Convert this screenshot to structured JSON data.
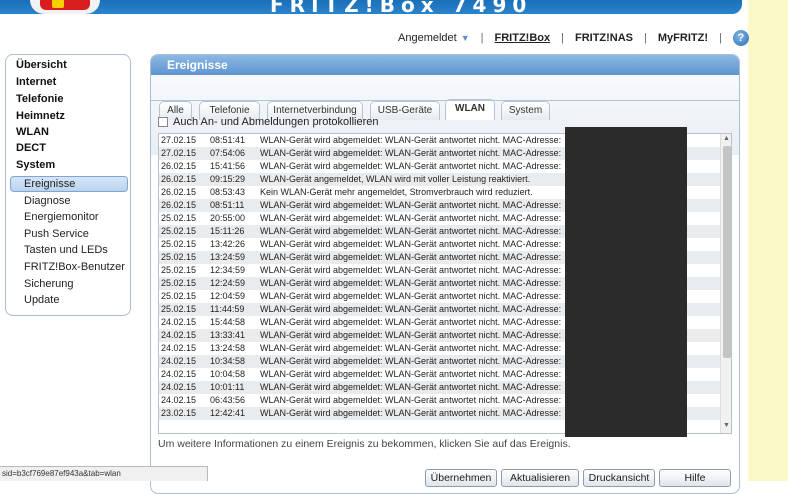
{
  "header": {
    "brand": "FRITZ!Box 7490"
  },
  "topnav": {
    "angemeldet": "Angemeldet",
    "fritzbox": "FRITZ!Box",
    "fritznas": "FRITZ!NAS",
    "myfritz": "MyFRITZ!",
    "sep": "|",
    "help": "?"
  },
  "menu": {
    "main": [
      "Übersicht",
      "Internet",
      "Telefonie",
      "Heimnetz",
      "WLAN",
      "DECT",
      "System"
    ],
    "sub": [
      "Ereignisse",
      "Diagnose",
      "Energiemonitor",
      "Push Service",
      "Tasten und LEDs",
      "FRITZ!Box-Benutzer",
      "Sicherung",
      "Update"
    ]
  },
  "panel": {
    "title": "Ereignisse",
    "tabs": [
      "Alle",
      "Telefonie",
      "Internetverbindung",
      "USB-Geräte",
      "WLAN",
      "System"
    ],
    "active_tab": "WLAN",
    "checkbox_label": "Auch An- und Abmeldungen protokollieren",
    "info": "Um weitere Informationen zu einem Ereignis zu bekommen, klicken Sie auf das Ereignis."
  },
  "events": [
    {
      "date": "27.02.15",
      "time": "08:51:41",
      "msg": "WLAN-Gerät wird abgemeldet: WLAN-Gerät antwortet nicht. MAC-Adresse:"
    },
    {
      "date": "27.02.15",
      "time": "07:54:06",
      "msg": "WLAN-Gerät wird abgemeldet: WLAN-Gerät antwortet nicht. MAC-Adresse:"
    },
    {
      "date": "26.02.15",
      "time": "15:41:56",
      "msg": "WLAN-Gerät wird abgemeldet: WLAN-Gerät antwortet nicht. MAC-Adresse:"
    },
    {
      "date": "26.02.15",
      "time": "09:15:29",
      "msg": "WLAN-Gerät angemeldet, WLAN wird mit voller Leistung reaktiviert."
    },
    {
      "date": "26.02.15",
      "time": "08:53:43",
      "msg": "Kein WLAN-Gerät mehr angemeldet, Stromverbrauch wird reduziert."
    },
    {
      "date": "26.02.15",
      "time": "08:51:11",
      "msg": "WLAN-Gerät wird abgemeldet: WLAN-Gerät antwortet nicht. MAC-Adresse:"
    },
    {
      "date": "25.02.15",
      "time": "20:55:00",
      "msg": "WLAN-Gerät wird abgemeldet: WLAN-Gerät antwortet nicht. MAC-Adresse:"
    },
    {
      "date": "25.02.15",
      "time": "15:11:26",
      "msg": "WLAN-Gerät wird abgemeldet: WLAN-Gerät antwortet nicht. MAC-Adresse:"
    },
    {
      "date": "25.02.15",
      "time": "13:42:26",
      "msg": "WLAN-Gerät wird abgemeldet: WLAN-Gerät antwortet nicht. MAC-Adresse:"
    },
    {
      "date": "25.02.15",
      "time": "13:24:59",
      "msg": "WLAN-Gerät wird abgemeldet: WLAN-Gerät antwortet nicht. MAC-Adresse:"
    },
    {
      "date": "25.02.15",
      "time": "12:34:59",
      "msg": "WLAN-Gerät wird abgemeldet: WLAN-Gerät antwortet nicht. MAC-Adresse:"
    },
    {
      "date": "25.02.15",
      "time": "12:24:59",
      "msg": "WLAN-Gerät wird abgemeldet: WLAN-Gerät antwortet nicht. MAC-Adresse:"
    },
    {
      "date": "25.02.15",
      "time": "12:04:59",
      "msg": "WLAN-Gerät wird abgemeldet: WLAN-Gerät antwortet nicht. MAC-Adresse:"
    },
    {
      "date": "25.02.15",
      "time": "11:44:59",
      "msg": "WLAN-Gerät wird abgemeldet: WLAN-Gerät antwortet nicht. MAC-Adresse:"
    },
    {
      "date": "24.02.15",
      "time": "15:44:58",
      "msg": "WLAN-Gerät wird abgemeldet: WLAN-Gerät antwortet nicht. MAC-Adresse:"
    },
    {
      "date": "24.02.15",
      "time": "13:33:41",
      "msg": "WLAN-Gerät wird abgemeldet: WLAN-Gerät antwortet nicht. MAC-Adresse:"
    },
    {
      "date": "24.02.15",
      "time": "13:24:58",
      "msg": "WLAN-Gerät wird abgemeldet: WLAN-Gerät antwortet nicht. MAC-Adresse:"
    },
    {
      "date": "24.02.15",
      "time": "10:34:58",
      "msg": "WLAN-Gerät wird abgemeldet: WLAN-Gerät antwortet nicht. MAC-Adresse:"
    },
    {
      "date": "24.02.15",
      "time": "10:04:58",
      "msg": "WLAN-Gerät wird abgemeldet: WLAN-Gerät antwortet nicht. MAC-Adresse:"
    },
    {
      "date": "24.02.15",
      "time": "10:01:11",
      "msg": "WLAN-Gerät wird abgemeldet: WLAN-Gerät antwortet nicht. MAC-Adresse:"
    },
    {
      "date": "24.02.15",
      "time": "06:43:56",
      "msg": "WLAN-Gerät wird abgemeldet: WLAN-Gerät antwortet nicht. MAC-Adresse:"
    },
    {
      "date": "23.02.15",
      "time": "12:42:41",
      "msg": "WLAN-Gerät wird abgemeldet: WLAN-Gerät antwortet nicht. MAC-Adresse:"
    }
  ],
  "buttons": [
    "Übernehmen",
    "Aktualisieren",
    "Druckansicht",
    "Hilfe"
  ],
  "status_url": "sid=b3cf769e87ef943a&tab=wlan",
  "colors": {
    "accent": "#2a84cc",
    "panel_head": "#5d95d0",
    "selected_menu": "#b9d3ee"
  }
}
